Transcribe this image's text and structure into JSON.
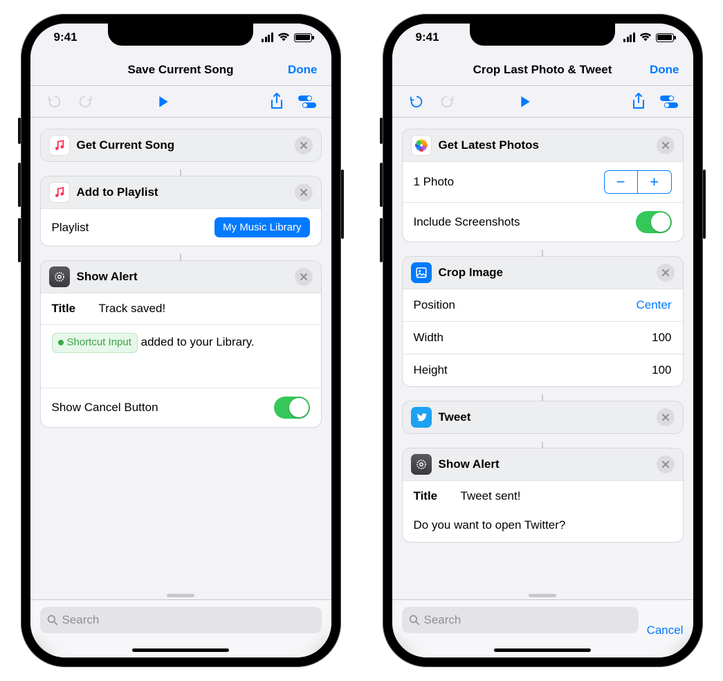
{
  "status": {
    "time": "9:41"
  },
  "phones": [
    {
      "title": "Save Current Song",
      "done": "Done",
      "toolbar": {
        "undo_enabled": false,
        "redo_enabled": false
      },
      "actions": {
        "a0": {
          "title": "Get Current Song"
        },
        "a1": {
          "title": "Add to Playlist",
          "param_label": "Playlist",
          "param_value": "My Music Library"
        },
        "a2": {
          "title": "Show Alert",
          "title_label": "Title",
          "title_value": "Track saved!",
          "token": "Shortcut Input",
          "body_suffix": " added to your Library.",
          "cancel_label": "Show Cancel Button"
        }
      },
      "search_placeholder": "Search",
      "show_cancel_btn": false
    },
    {
      "title": "Crop Last Photo & Tweet",
      "done": "Done",
      "toolbar": {
        "undo_enabled": true,
        "redo_enabled": false
      },
      "actions": {
        "b0": {
          "title": "Get Latest Photos",
          "count_label": "1 Photo",
          "screenshots_label": "Include Screenshots"
        },
        "b1": {
          "title": "Crop Image",
          "pos_label": "Position",
          "pos_value": "Center",
          "w_label": "Width",
          "w_value": "100",
          "h_label": "Height",
          "h_value": "100"
        },
        "b2": {
          "title": "Tweet"
        },
        "b3": {
          "title": "Show Alert",
          "title_label": "Title",
          "title_value": "Tweet sent!",
          "body": "Do you want to open Twitter?"
        }
      },
      "search_placeholder": "Search",
      "cancel_label": "Cancel",
      "show_cancel_btn": true
    }
  ]
}
